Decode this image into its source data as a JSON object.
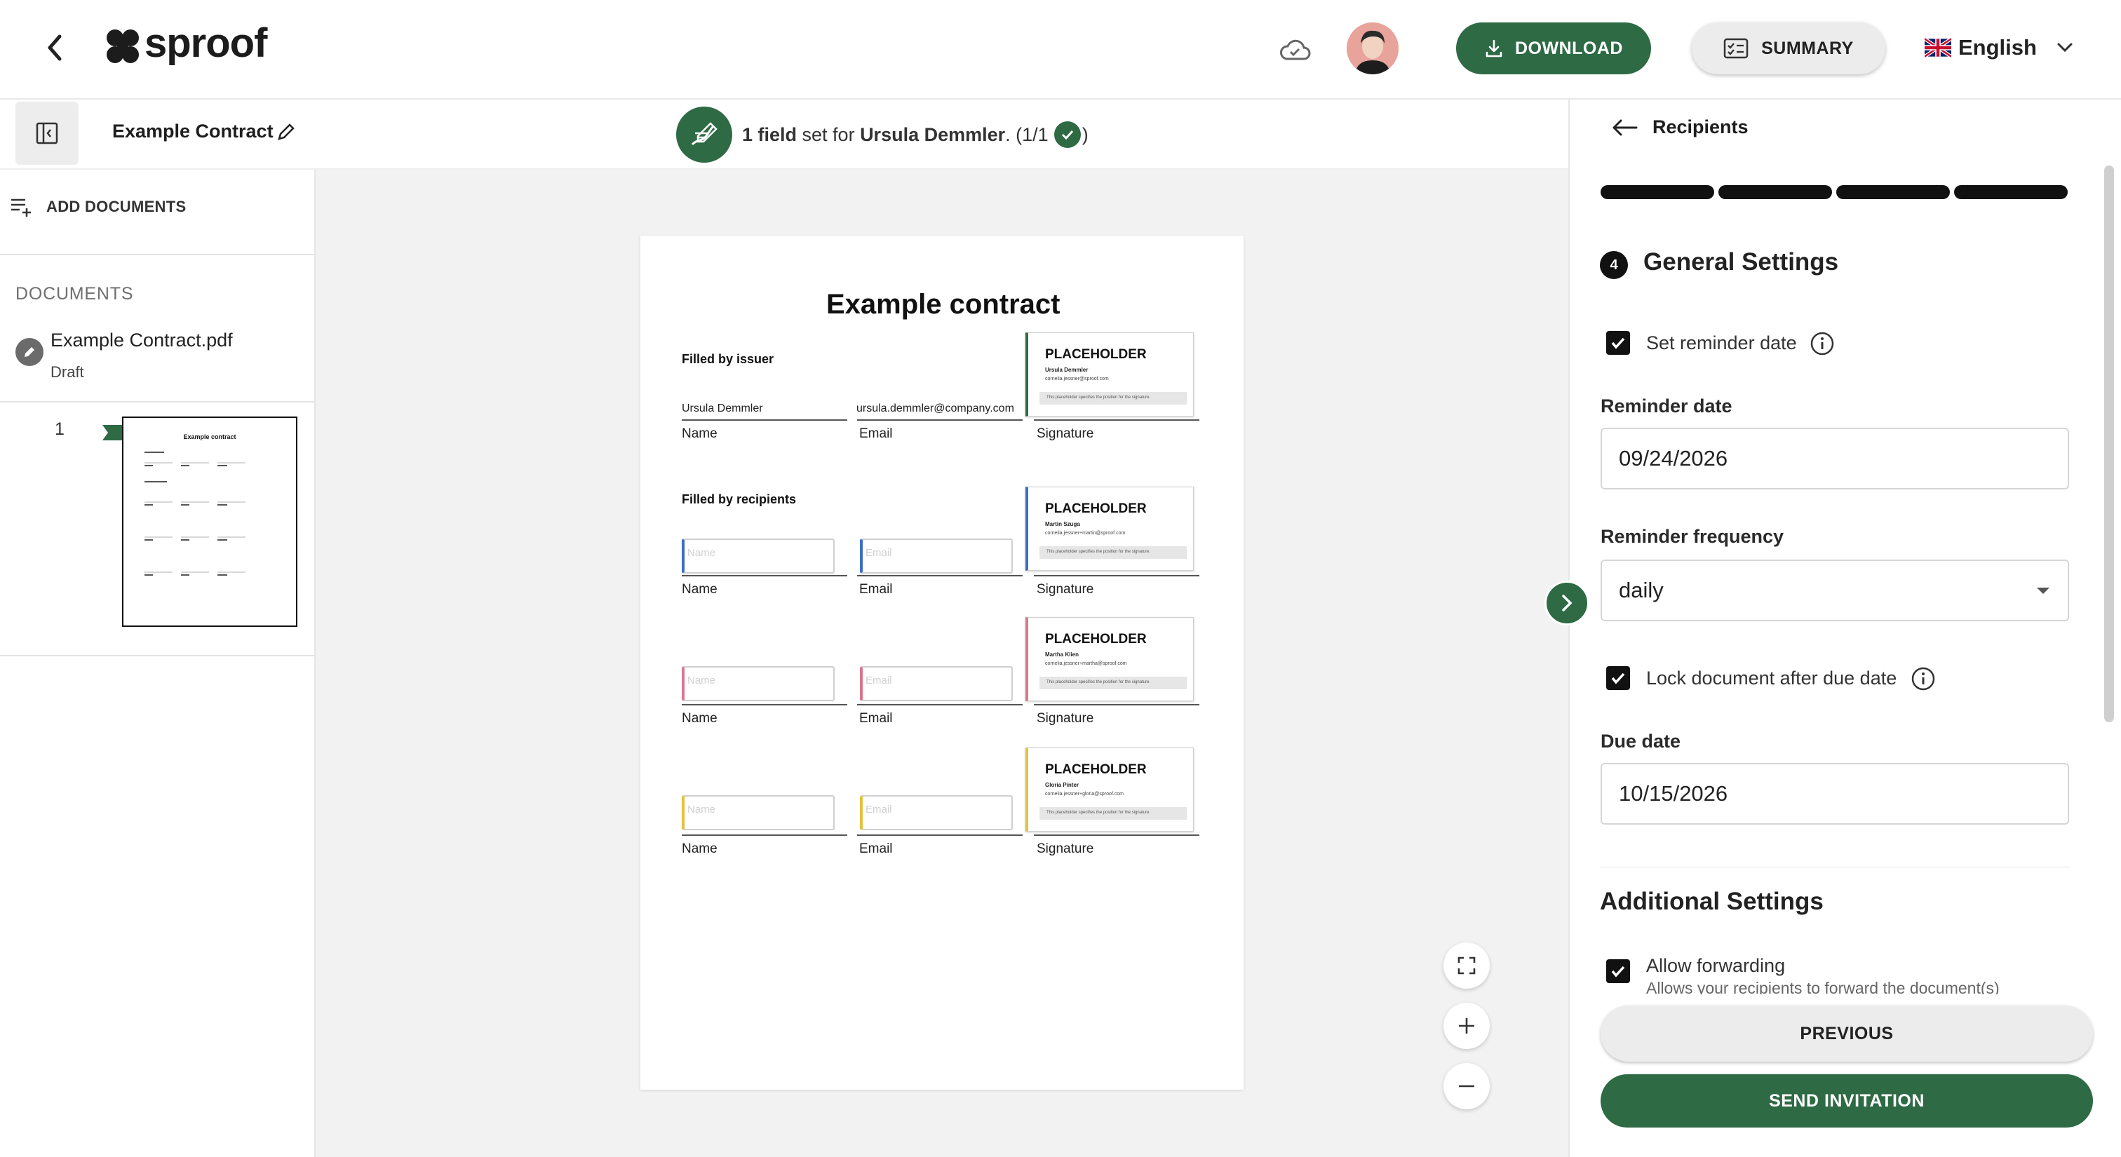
{
  "app": {
    "logo_text": "sproof"
  },
  "header": {
    "download_label": "DOWNLOAD",
    "summary_label": "SUMMARY",
    "language": "English",
    "accent_color": "#2e6a44"
  },
  "subbar": {
    "document_title": "Example Contract",
    "status_count": "1 field",
    "status_middle": " set for ",
    "status_name": "Ursula Demmler",
    "status_progress": ". (1/1",
    "status_end": " )"
  },
  "sidebar": {
    "add_documents_label": "ADD DOCUMENTS",
    "documents_header": "DOCUMENTS",
    "documents": [
      {
        "name": "Example Contract.pdf",
        "status": "Draft"
      }
    ],
    "page_number": "1"
  },
  "document_page": {
    "title": "Example contract",
    "issuer_section": "Filled by issuer",
    "issuer_name_value": "Ursula Demmler",
    "issuer_email_value": "ursula.demmler@company.com",
    "recipients_section": "Filled by recipients",
    "label_name": "Name",
    "label_email": "Email",
    "label_signature": "Signature",
    "input_placeholder_name": "Name",
    "input_placeholder_email": "Email",
    "placeholder_title": "PLACEHOLDER",
    "placeholders": [
      {
        "name": "Ursula Demmler",
        "mail": "cornelia.jessner@sproof.com",
        "color": "#2e6a44"
      },
      {
        "name": "Martin Szuga",
        "mail": "cornelia.jessner+martin@sproof.com",
        "color": "#3b6fc4"
      },
      {
        "name": "Martha Klien",
        "mail": "cornelia.jessner+martha@sproof.com",
        "color": "#d9778f"
      },
      {
        "name": "Gloria Pinter",
        "mail": "cornelia.jessner+gloria@sproof.com",
        "color": "#e3c23f"
      }
    ],
    "placeholder_footer": "This placeholder specifies the position for the signature."
  },
  "right_panel": {
    "header": "Recipients",
    "step_number": "4",
    "general_title": "General Settings",
    "set_reminder_label": "Set reminder date",
    "reminder_date_label": "Reminder date",
    "reminder_date_value": "09/24/2026",
    "reminder_frequency_label": "Reminder frequency",
    "reminder_frequency_value": "daily",
    "lock_document_label": "Lock document after due date",
    "due_date_label": "Due date",
    "due_date_value": "10/15/2026",
    "additional_title": "Additional Settings",
    "allow_forwarding_label": "Allow forwarding",
    "allow_forwarding_desc": "Allows your recipients to forward the document(s)",
    "previous_label": "PREVIOUS",
    "send_label": "SEND INVITATION"
  }
}
